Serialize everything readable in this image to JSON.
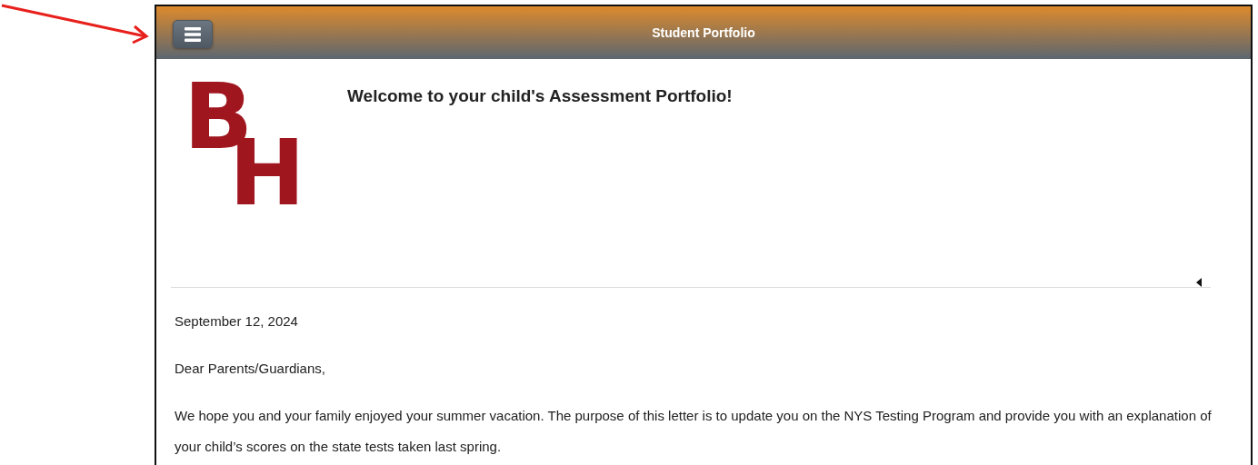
{
  "header": {
    "title": "Student Portfolio"
  },
  "logo": {
    "letters": [
      "B",
      "H"
    ]
  },
  "heading": "Welcome to your child's Assessment Portfolio!",
  "letter": {
    "date": "September 12, 2024",
    "greeting": "Dear Parents/Guardians,",
    "paragraphs": [
      "We hope you and your family enjoyed your summer vacation. The purpose of this letter is to update you on the NYS Testing Program and provide you with an explanation of your child’s scores on the state tests taken last spring."
    ]
  }
}
